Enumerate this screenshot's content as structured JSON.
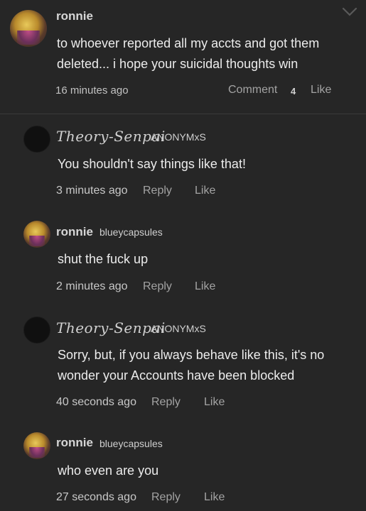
{
  "post": {
    "username": "ronnie",
    "text_lines": [
      "to whoever reported all my accts and got them",
      "deleted... i hope your suicidal thoughts win"
    ],
    "time": "16 minutes ago",
    "comment_label": "Comment",
    "comment_count": "4",
    "like_label": "Like"
  },
  "replies": [
    {
      "display_name": "Theory-Senpai",
      "handle": "ANONYMxS",
      "text_lines": [
        "You shouldn't say things like that!"
      ],
      "time": "3 minutes ago",
      "reply_label": "Reply",
      "like_label": "Like"
    },
    {
      "display_name": "ronnie",
      "handle": "blueycapsules",
      "text_lines": [
        "shut the fuck up"
      ],
      "time": "2 minutes ago",
      "reply_label": "Reply",
      "like_label": "Like"
    },
    {
      "display_name": "Theory-Senpai",
      "handle": "ANONYMxS",
      "text_lines": [
        "Sorry, but, if you always behave like this, it's no",
        "wonder your Accounts have been blocked"
      ],
      "time": "40 seconds ago",
      "reply_label": "Reply",
      "like_label": "Like"
    },
    {
      "display_name": "ronnie",
      "handle": "blueycapsules",
      "text_lines": [
        "who even are you"
      ],
      "time": "27 seconds ago",
      "reply_label": "Reply",
      "like_label": "Like"
    }
  ],
  "icons": {
    "collapse": "chevron-down-icon"
  }
}
